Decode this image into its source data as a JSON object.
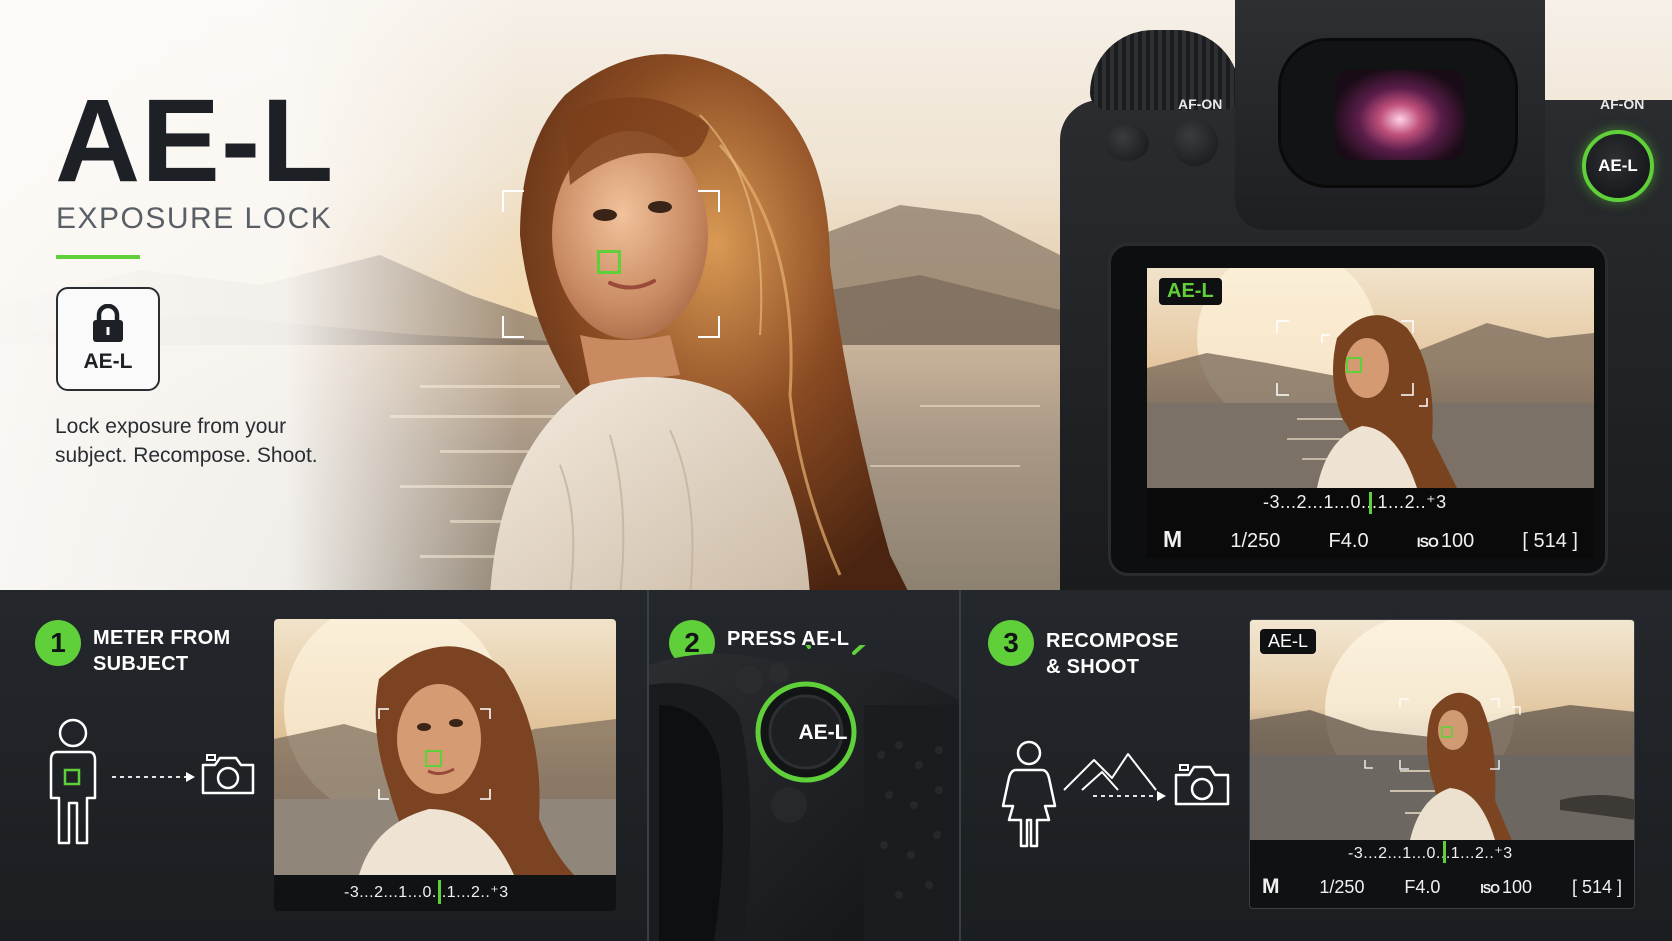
{
  "hero": {
    "title": "AE-L",
    "subtitle": "EXPOSURE LOCK",
    "lock_label": "AE-L",
    "description": "Lock exposure from your subject. Recompose. Shoot."
  },
  "camera": {
    "af_on_left": "AF-ON",
    "af_on_right": "AF-ON",
    "ael_button": "AE-L",
    "screen": {
      "badge": "AE-L",
      "meter": "-3...2...1...0...1...2..⁺3",
      "mode": "M",
      "shutter": "1/250",
      "aperture": "F4.0",
      "iso_label": "ISO",
      "iso_value": "100",
      "shots": "[ 514 ]"
    }
  },
  "steps": [
    {
      "number": "1",
      "title_line1": "METER FROM",
      "title_line2": "SUBJECT",
      "meter": "-3...2...1...0...1...2..⁺3"
    },
    {
      "number": "2",
      "title_line1": "PRESS AE-L",
      "button_label": "AE-L"
    },
    {
      "number": "3",
      "title_line1": "RECOMPOSE",
      "title_line2": "& SHOOT",
      "badge": "AE-L",
      "meter": "-3...2...1...0...1...2..⁺3",
      "mode": "M",
      "shutter": "1/250",
      "aperture": "F4.0",
      "iso_label": "ISO",
      "iso_value": "100",
      "shots": "[ 514 ]"
    }
  ],
  "colors": {
    "accent": "#5fd03a",
    "panel_bg": "#1f2326",
    "title_dark": "#1d2126"
  }
}
